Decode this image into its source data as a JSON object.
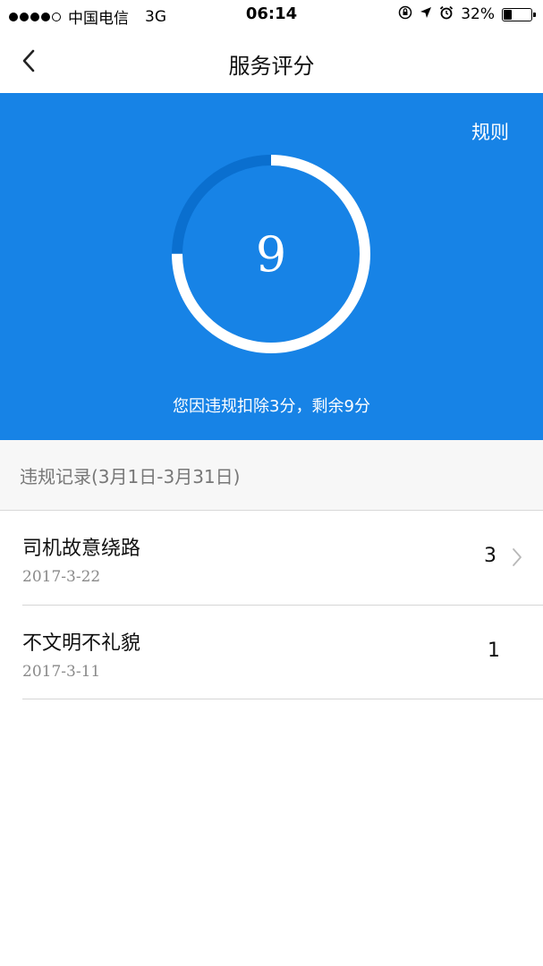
{
  "status_bar": {
    "carrier": "中国电信",
    "network": "3G",
    "time": "06:14",
    "battery": "32%",
    "battery_level": 0.32
  },
  "nav": {
    "title": "服务评分",
    "back_icon": "chevron-left-icon"
  },
  "score": {
    "rules_label": "规则",
    "value": "9",
    "max": 12,
    "remaining": 9,
    "caption": "您因违规扣除3分，剩余9分",
    "ring_color": "#ffffff",
    "deducted_color": "#0a6fcf",
    "background": "#1783e6"
  },
  "violations": {
    "header": "违规记录(3月1日-3月31日)",
    "items": [
      {
        "title": "司机故意绕路",
        "date": "2017-3-22",
        "points": "3",
        "has_chevron": true
      },
      {
        "title": "不文明不礼貌",
        "date": "2017-3-11",
        "points": "1",
        "has_chevron": false
      }
    ]
  }
}
